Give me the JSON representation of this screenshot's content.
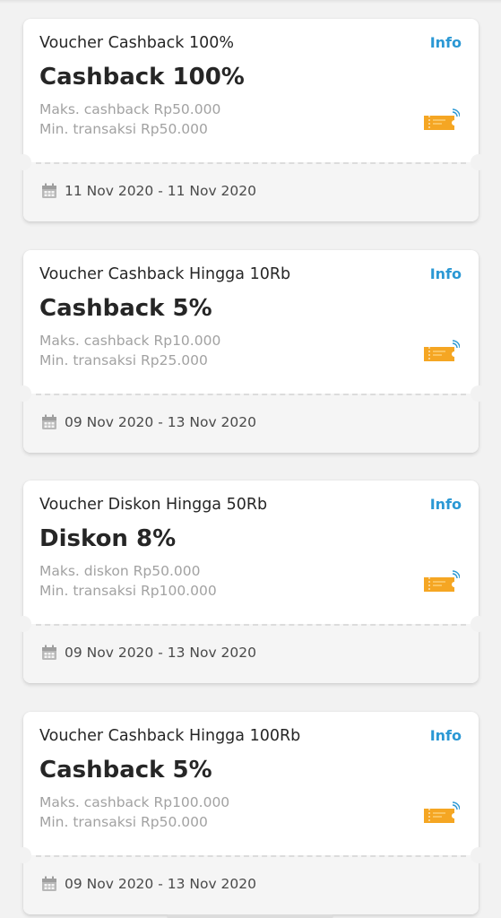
{
  "info_label": "Info",
  "colors": {
    "accent": "#2b98d4",
    "ticket": "#f5a623"
  },
  "icons": {
    "voucher": "ticket-icon",
    "period": "calendar-icon"
  },
  "vouchers": [
    {
      "title": "Voucher Cashback 100%",
      "headline": "Cashback 100%",
      "max_line": "Maks. cashback Rp50.000",
      "min_line": "Min. transaksi Rp50.000",
      "period": "11 Nov 2020 - 11 Nov 2020"
    },
    {
      "title": "Voucher Cashback Hingga 10Rb",
      "headline": "Cashback 5%",
      "max_line": "Maks. cashback Rp10.000",
      "min_line": "Min. transaksi Rp25.000",
      "period": "09 Nov 2020 - 13 Nov 2020"
    },
    {
      "title": "Voucher Diskon Hingga 50Rb",
      "headline": "Diskon 8%",
      "max_line": "Maks. diskon Rp50.000",
      "min_line": "Min. transaksi Rp100.000",
      "period": "09 Nov 2020 - 13 Nov 2020"
    },
    {
      "title": "Voucher Cashback Hingga 100Rb",
      "headline": "Cashback 5%",
      "max_line": "Maks. cashback Rp100.000",
      "min_line": "Min. transaksi Rp50.000",
      "period": "09 Nov 2020 - 13 Nov 2020"
    }
  ]
}
